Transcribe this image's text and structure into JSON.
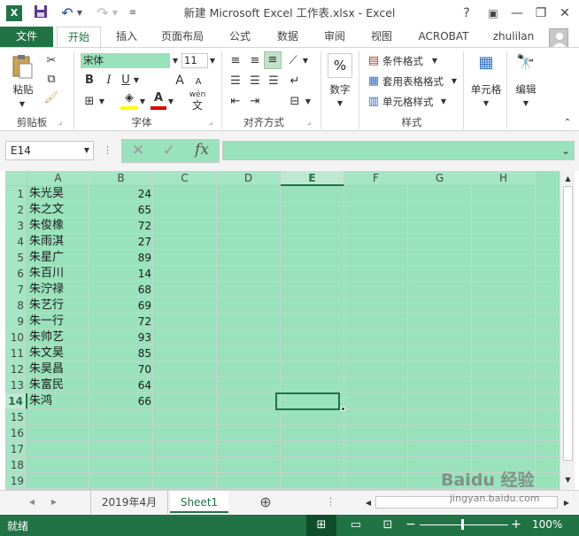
{
  "titlebar": {
    "title": "新建 Microsoft Excel 工作表.xlsx - Excel",
    "help": "?",
    "minimize": "—",
    "restore": "❐",
    "close": "✕"
  },
  "tabs": {
    "file": "文件",
    "home": "开始",
    "insert": "插入",
    "page_layout": "页面布局",
    "formulas": "公式",
    "data": "数据",
    "review": "审阅",
    "view": "视图",
    "acrobat": "ACROBAT",
    "user": "zhulilan"
  },
  "ribbon": {
    "clipboard": {
      "paste": "粘贴",
      "group_label": "剪贴板"
    },
    "font": {
      "font_name": "宋体",
      "font_size": "11",
      "group_label": "字体",
      "bold": "B",
      "italic": "I",
      "underline": "U",
      "grow": "A",
      "shrink": "A",
      "wen": "wén",
      "font_color_letter": "A",
      "highlight_letter": "A"
    },
    "alignment": {
      "group_label": "对齐方式"
    },
    "number": {
      "label": "数字",
      "symbol": "%"
    },
    "styles": {
      "conditional": "条件格式",
      "table": "套用表格格式",
      "cell_styles": "单元格样式",
      "group_label": "样式"
    },
    "cells": {
      "label": "单元格"
    },
    "editing": {
      "label": "编辑"
    }
  },
  "formula_bar": {
    "name_box": "E14",
    "cancel": "✕",
    "enter": "✓",
    "fx": "fx",
    "formula": ""
  },
  "sheet": {
    "columns": [
      "A",
      "B",
      "C",
      "D",
      "E",
      "F",
      "G",
      "H"
    ],
    "selected_column": "E",
    "selected_row": 14,
    "rows": [
      {
        "n": "1",
        "name": "朱光昊",
        "value": "24"
      },
      {
        "n": "2",
        "name": "朱之文",
        "value": "65"
      },
      {
        "n": "3",
        "name": "朱俊橡",
        "value": "72"
      },
      {
        "n": "4",
        "name": "朱雨淇",
        "value": "27"
      },
      {
        "n": "5",
        "name": "朱星广",
        "value": "89"
      },
      {
        "n": "6",
        "name": "朱百川",
        "value": "14"
      },
      {
        "n": "7",
        "name": "朱泞禄",
        "value": "68"
      },
      {
        "n": "8",
        "name": "朱艺行",
        "value": "69"
      },
      {
        "n": "9",
        "name": "朱一行",
        "value": "72"
      },
      {
        "n": "10",
        "name": "朱帅艺",
        "value": "93"
      },
      {
        "n": "11",
        "name": "朱文昊",
        "value": "85"
      },
      {
        "n": "12",
        "name": "朱昊昌",
        "value": "70"
      },
      {
        "n": "13",
        "name": "朱富民",
        "value": "64"
      },
      {
        "n": "14",
        "name": "朱鸿",
        "value": "66"
      },
      {
        "n": "15",
        "name": "",
        "value": ""
      },
      {
        "n": "16",
        "name": "",
        "value": ""
      },
      {
        "n": "17",
        "name": "",
        "value": ""
      },
      {
        "n": "18",
        "name": "",
        "value": ""
      },
      {
        "n": "19",
        "name": "",
        "value": ""
      }
    ]
  },
  "sheet_tabs": {
    "tab1": "2019年4月",
    "tab2": "Sheet1",
    "add": "⊕",
    "prev": "◀",
    "next": "▶"
  },
  "status": {
    "ready": "就绪",
    "zoom": "100%",
    "minus": "−",
    "plus": "+"
  },
  "watermark": {
    "line1": "Baidu 经验",
    "line2": "jingyan.baidu.com"
  },
  "colors": {
    "excel_green": "#217346",
    "grid_bg": "#99e2bb"
  }
}
